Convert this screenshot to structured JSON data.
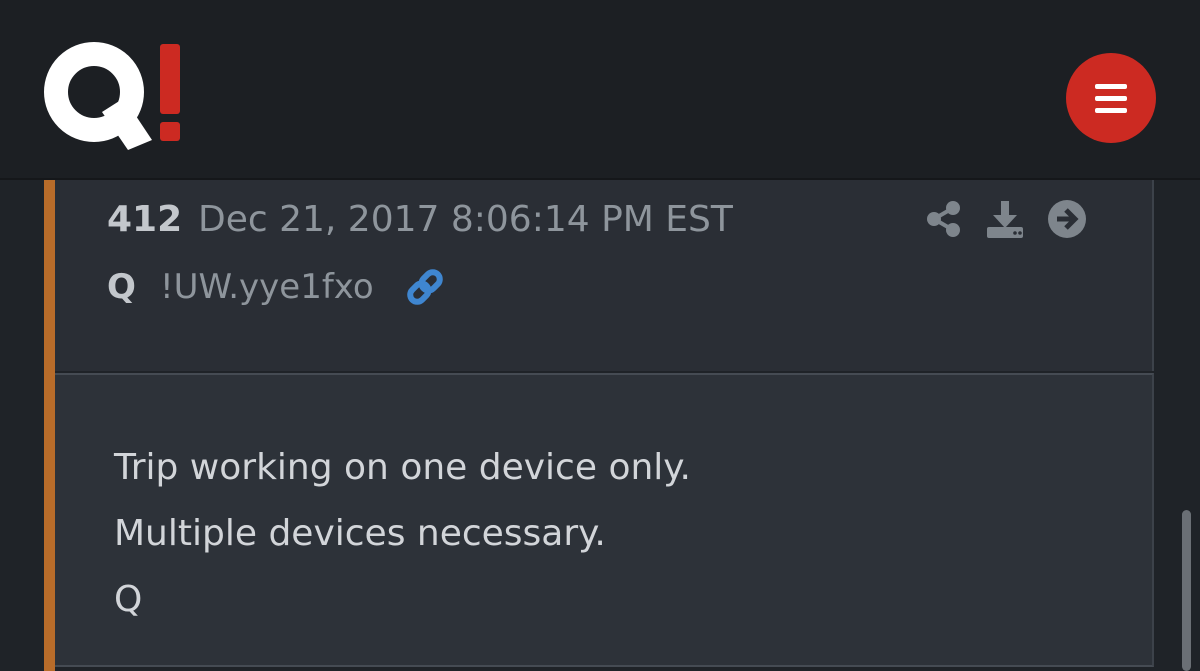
{
  "header": {
    "logo": {
      "letter": "Q",
      "mark": "!",
      "mark_color": "#cc2a22"
    },
    "menu_icon": "hamburger-menu-icon",
    "menu_color": "#cc2a22"
  },
  "post": {
    "number": "412",
    "datetime": "Dec 21, 2017 8:06:14 PM EST",
    "author": "Q",
    "tripcode": "!UW.yye1fxo",
    "link_icon": "link-icon",
    "actions": [
      "share-icon",
      "download-icon",
      "arrow-right-circle-icon"
    ],
    "accent_color": "#b86c2a",
    "body_lines": [
      "Trip working on one device only.",
      "Multiple devices necessary.",
      "Q"
    ]
  }
}
